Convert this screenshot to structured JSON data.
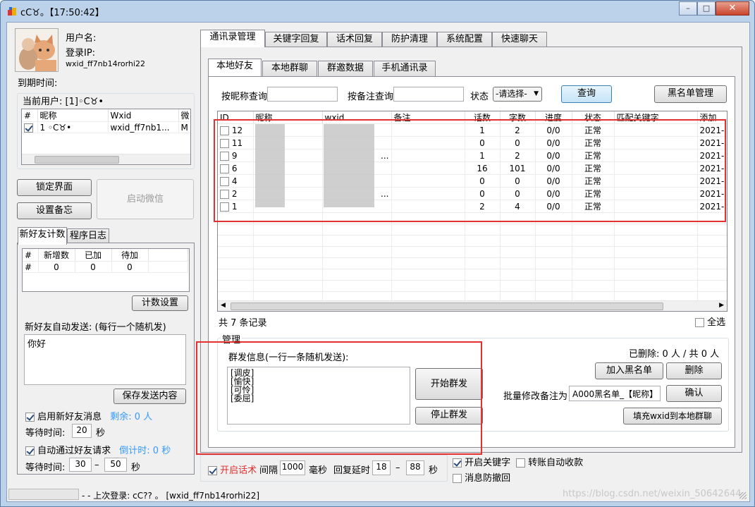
{
  "window": {
    "title": "cC♉︎。【17:50:42】",
    "min": "–",
    "max": "□",
    "close": "✕"
  },
  "user": {
    "username_label": "用户名:",
    "login_ip_label": "登录IP:",
    "wxid": "wxid_ff7nb14rorhi22",
    "expire_label": "到期时间:",
    "current_user_label": "当前用户: [1]◦C♉•"
  },
  "user_table": {
    "headers": [
      "#",
      "昵称",
      "Wxid",
      "微"
    ],
    "row": {
      "num": "1",
      "nick": "◦C♉•",
      "wxid": "wxid_ff7nb1...",
      "extra": "M"
    }
  },
  "left_buttons": {
    "lock": "锁定界面",
    "remark": "设置备忘",
    "start_wechat": "启动微信"
  },
  "left_tabs": [
    "新好友计数",
    "程序日志"
  ],
  "count_table": {
    "headers": [
      "#",
      "新增数",
      "已加",
      "待加"
    ],
    "row": [
      "#",
      "0",
      "0",
      "0"
    ]
  },
  "count_settings": "计数设置",
  "auto_send_label": "新好友自动发送: (每行一个随机发)",
  "auto_send_text": "你好",
  "save_content": "保存发送内容",
  "enable_msg": {
    "label": "启用新好友消息",
    "remaining": "剩余: 0 人"
  },
  "wait1": {
    "label": "等待时间:",
    "value": "20",
    "unit": "秒"
  },
  "auto_accept": {
    "label": "自动通过好友请求",
    "countdown": "倒计时: 0 秒"
  },
  "wait2": {
    "label": "等待时间:",
    "from": "30",
    "dash": "–",
    "to": "50",
    "unit": "秒"
  },
  "main_tabs": [
    "通讯录管理",
    "关键字回复",
    "话术回复",
    "防护清理",
    "系统配置",
    "快速聊天"
  ],
  "sub_tabs": [
    "本地好友",
    "本地群聊",
    "群邀数据",
    "手机通讯录"
  ],
  "search": {
    "nick_label": "按昵称查询",
    "remark_label": "按备注查询",
    "status_label": "状态",
    "status_value": "-请选择-",
    "query": "查询",
    "blacklist_mgmt": "黑名单管理"
  },
  "friends_table": {
    "headers": [
      "ID",
      "昵称",
      "wxid",
      "备注",
      "话数",
      "字数",
      "进度",
      "状态",
      "匹配关键字",
      "添加"
    ],
    "rows": [
      {
        "id": "12",
        "wxid": "",
        "talks": "1",
        "chars": "2",
        "progress": "0/0",
        "status": "正常",
        "added": "2021-"
      },
      {
        "id": "11",
        "wxid": "",
        "talks": "0",
        "chars": "0",
        "progress": "0/0",
        "status": "正常",
        "added": "2021-"
      },
      {
        "id": "9",
        "wxid": "...",
        "talks": "1",
        "chars": "2",
        "progress": "0/0",
        "status": "正常",
        "added": "2021-"
      },
      {
        "id": "6",
        "wxid": "",
        "talks": "16",
        "chars": "101",
        "progress": "0/0",
        "status": "正常",
        "added": "2021-"
      },
      {
        "id": "4",
        "wxid": "",
        "talks": "0",
        "chars": "0",
        "progress": "0/0",
        "status": "正常",
        "added": "2021-"
      },
      {
        "id": "2",
        "wxid": "...",
        "talks": "0",
        "chars": "0",
        "progress": "0/0",
        "status": "正常",
        "added": "2021-"
      },
      {
        "id": "1",
        "wxid": "",
        "talks": "2",
        "chars": "4",
        "progress": "0/0",
        "status": "正常",
        "added": "2021-"
      }
    ]
  },
  "records": "共 7 条记录",
  "select_all": "全选",
  "manage": {
    "title": "管理",
    "bulk_label": "群发信息(一行一条随机发送):",
    "bulk_text": "[调皮]\n[愉快]\n[可怜]\n[委屈]",
    "start": "开始群发",
    "stop": "停止群发",
    "deleted": "已删除: 0 人 / 共 0 人",
    "add_blacklist": "加入黑名单",
    "delete": "删除",
    "batch_label": "批量修改备注为",
    "batch_value": "A000黑名单_【昵称】",
    "confirm": "确认",
    "fill_wxid": "填充wxid到本地群聊"
  },
  "bottom": {
    "script": "开启话术",
    "interval_label": "间隔",
    "interval": "1000",
    "ms": "毫秒",
    "delay_label": "回复延时",
    "delay_from": "18",
    "dash": "–",
    "delay_to": "88",
    "sec": "秒",
    "keyword": "开启关键字",
    "transfer": "转账自动收款",
    "anti_recall": "消息防撤回"
  },
  "statusbar": {
    "text": "- - 上次登录: cC?? 。 [wxid_ff7nb14rorhi22]"
  },
  "watermark": "https://blog.csdn.net/weixin_50642644",
  "colors": {
    "highlight": "#e53030",
    "accent_text": "#3399ff",
    "red_text": "#e03030"
  }
}
